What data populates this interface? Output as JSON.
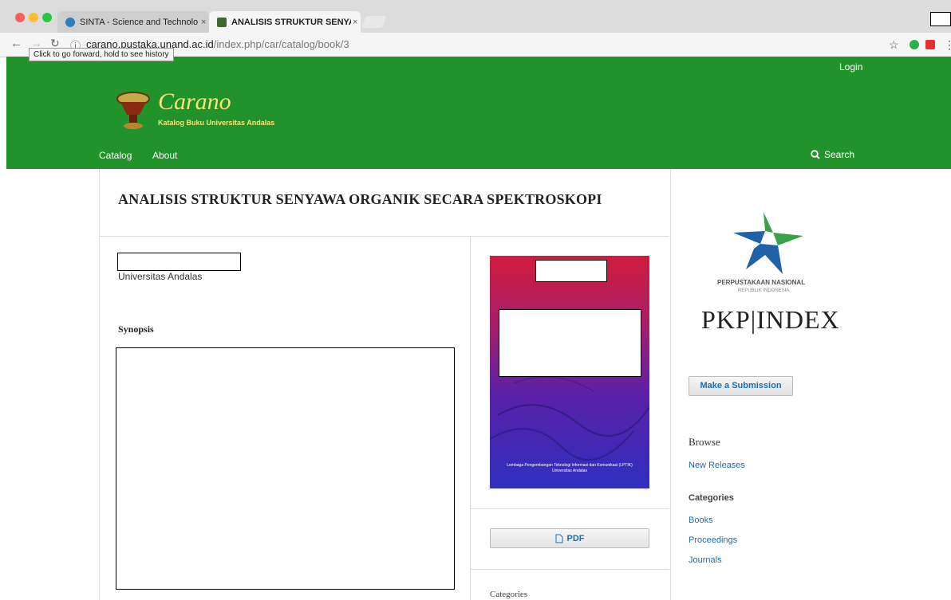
{
  "browser": {
    "tabs": [
      {
        "title": "SINTA - Science and Technolo",
        "close": "×"
      },
      {
        "title": "ANALISIS STRUKTUR SENYAW",
        "close": "×"
      }
    ],
    "url_host": "carano.pustaka.unand.ac.id",
    "url_path": "/index.php/car/catalog/book/3",
    "tooltip": "Click to go forward, hold to see history"
  },
  "header": {
    "login": "Login",
    "brand": "Carano",
    "tagline": "Katalog Buku Universitas Andalas",
    "menu": [
      {
        "label": "Catalog"
      },
      {
        "label": "About"
      }
    ],
    "search": "Search"
  },
  "book": {
    "title": "ANALISIS STRUKTUR SENYAWA ORGANIK SECARA SPEKTROSKOPI",
    "affiliation": "Universitas Andalas",
    "synopsis_label": "Synopsis",
    "cover_footer": "Lembaga Pengembangan Teknologi Informasi dan Komunikasi (LPTIK) Universitas Andalas",
    "pdf_label": "PDF",
    "categories_label": "Categories"
  },
  "sidebar": {
    "perpus_line1": "PERPUSTAKAAN NASIONAL",
    "perpus_line2": "REPUBLIK INDONESIA",
    "pkp_index": "PKP|INDEX",
    "submit": "Make a Submission",
    "browse": "Browse",
    "new_releases": "New Releases",
    "categories_title": "Categories",
    "categories": [
      {
        "label": "Books"
      },
      {
        "label": "Proceedings"
      },
      {
        "label": "Journals"
      }
    ]
  },
  "colors": {
    "header_green": "#22922a",
    "link_blue": "#1a6fb3",
    "brand_yellow": "#f2e57a"
  }
}
